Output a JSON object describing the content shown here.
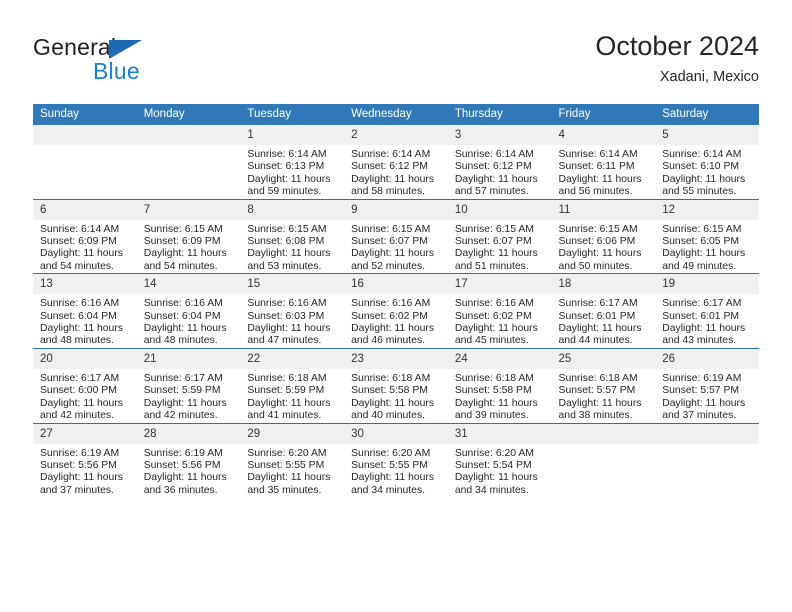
{
  "brand": {
    "name_line1": "General",
    "name_line2": "Blue",
    "accent_color": "#1b7fd4",
    "triangle_color": "#1b6ab3"
  },
  "header": {
    "title": "October 2024",
    "subtitle": "Xadani, Mexico",
    "header_bg": "#3178b9",
    "row_divider_color": "#2f6fa8",
    "daynum_bg": "#f0f0f0"
  },
  "weekdays": [
    "Sunday",
    "Monday",
    "Tuesday",
    "Wednesday",
    "Thursday",
    "Friday",
    "Saturday"
  ],
  "labels": {
    "sunrise_prefix": "Sunrise:",
    "sunset_prefix": "Sunset:",
    "daylight_prefix": "Daylight:"
  },
  "weeks": [
    [
      {
        "day": "",
        "sunrise": "",
        "sunset": "",
        "daylight": ""
      },
      {
        "day": "",
        "sunrise": "",
        "sunset": "",
        "daylight": ""
      },
      {
        "day": "1",
        "sunrise": "Sunrise: 6:14 AM",
        "sunset": "Sunset: 6:13 PM",
        "daylight": "Daylight: 11 hours and 59 minutes."
      },
      {
        "day": "2",
        "sunrise": "Sunrise: 6:14 AM",
        "sunset": "Sunset: 6:12 PM",
        "daylight": "Daylight: 11 hours and 58 minutes."
      },
      {
        "day": "3",
        "sunrise": "Sunrise: 6:14 AM",
        "sunset": "Sunset: 6:12 PM",
        "daylight": "Daylight: 11 hours and 57 minutes."
      },
      {
        "day": "4",
        "sunrise": "Sunrise: 6:14 AM",
        "sunset": "Sunset: 6:11 PM",
        "daylight": "Daylight: 11 hours and 56 minutes."
      },
      {
        "day": "5",
        "sunrise": "Sunrise: 6:14 AM",
        "sunset": "Sunset: 6:10 PM",
        "daylight": "Daylight: 11 hours and 55 minutes."
      }
    ],
    [
      {
        "day": "6",
        "sunrise": "Sunrise: 6:14 AM",
        "sunset": "Sunset: 6:09 PM",
        "daylight": "Daylight: 11 hours and 54 minutes."
      },
      {
        "day": "7",
        "sunrise": "Sunrise: 6:15 AM",
        "sunset": "Sunset: 6:09 PM",
        "daylight": "Daylight: 11 hours and 54 minutes."
      },
      {
        "day": "8",
        "sunrise": "Sunrise: 6:15 AM",
        "sunset": "Sunset: 6:08 PM",
        "daylight": "Daylight: 11 hours and 53 minutes."
      },
      {
        "day": "9",
        "sunrise": "Sunrise: 6:15 AM",
        "sunset": "Sunset: 6:07 PM",
        "daylight": "Daylight: 11 hours and 52 minutes."
      },
      {
        "day": "10",
        "sunrise": "Sunrise: 6:15 AM",
        "sunset": "Sunset: 6:07 PM",
        "daylight": "Daylight: 11 hours and 51 minutes."
      },
      {
        "day": "11",
        "sunrise": "Sunrise: 6:15 AM",
        "sunset": "Sunset: 6:06 PM",
        "daylight": "Daylight: 11 hours and 50 minutes."
      },
      {
        "day": "12",
        "sunrise": "Sunrise: 6:15 AM",
        "sunset": "Sunset: 6:05 PM",
        "daylight": "Daylight: 11 hours and 49 minutes."
      }
    ],
    [
      {
        "day": "13",
        "sunrise": "Sunrise: 6:16 AM",
        "sunset": "Sunset: 6:04 PM",
        "daylight": "Daylight: 11 hours and 48 minutes."
      },
      {
        "day": "14",
        "sunrise": "Sunrise: 6:16 AM",
        "sunset": "Sunset: 6:04 PM",
        "daylight": "Daylight: 11 hours and 48 minutes."
      },
      {
        "day": "15",
        "sunrise": "Sunrise: 6:16 AM",
        "sunset": "Sunset: 6:03 PM",
        "daylight": "Daylight: 11 hours and 47 minutes."
      },
      {
        "day": "16",
        "sunrise": "Sunrise: 6:16 AM",
        "sunset": "Sunset: 6:02 PM",
        "daylight": "Daylight: 11 hours and 46 minutes."
      },
      {
        "day": "17",
        "sunrise": "Sunrise: 6:16 AM",
        "sunset": "Sunset: 6:02 PM",
        "daylight": "Daylight: 11 hours and 45 minutes."
      },
      {
        "day": "18",
        "sunrise": "Sunrise: 6:17 AM",
        "sunset": "Sunset: 6:01 PM",
        "daylight": "Daylight: 11 hours and 44 minutes."
      },
      {
        "day": "19",
        "sunrise": "Sunrise: 6:17 AM",
        "sunset": "Sunset: 6:01 PM",
        "daylight": "Daylight: 11 hours and 43 minutes."
      }
    ],
    [
      {
        "day": "20",
        "sunrise": "Sunrise: 6:17 AM",
        "sunset": "Sunset: 6:00 PM",
        "daylight": "Daylight: 11 hours and 42 minutes."
      },
      {
        "day": "21",
        "sunrise": "Sunrise: 6:17 AM",
        "sunset": "Sunset: 5:59 PM",
        "daylight": "Daylight: 11 hours and 42 minutes."
      },
      {
        "day": "22",
        "sunrise": "Sunrise: 6:18 AM",
        "sunset": "Sunset: 5:59 PM",
        "daylight": "Daylight: 11 hours and 41 minutes."
      },
      {
        "day": "23",
        "sunrise": "Sunrise: 6:18 AM",
        "sunset": "Sunset: 5:58 PM",
        "daylight": "Daylight: 11 hours and 40 minutes."
      },
      {
        "day": "24",
        "sunrise": "Sunrise: 6:18 AM",
        "sunset": "Sunset: 5:58 PM",
        "daylight": "Daylight: 11 hours and 39 minutes."
      },
      {
        "day": "25",
        "sunrise": "Sunrise: 6:18 AM",
        "sunset": "Sunset: 5:57 PM",
        "daylight": "Daylight: 11 hours and 38 minutes."
      },
      {
        "day": "26",
        "sunrise": "Sunrise: 6:19 AM",
        "sunset": "Sunset: 5:57 PM",
        "daylight": "Daylight: 11 hours and 37 minutes."
      }
    ],
    [
      {
        "day": "27",
        "sunrise": "Sunrise: 6:19 AM",
        "sunset": "Sunset: 5:56 PM",
        "daylight": "Daylight: 11 hours and 37 minutes."
      },
      {
        "day": "28",
        "sunrise": "Sunrise: 6:19 AM",
        "sunset": "Sunset: 5:56 PM",
        "daylight": "Daylight: 11 hours and 36 minutes."
      },
      {
        "day": "29",
        "sunrise": "Sunrise: 6:20 AM",
        "sunset": "Sunset: 5:55 PM",
        "daylight": "Daylight: 11 hours and 35 minutes."
      },
      {
        "day": "30",
        "sunrise": "Sunrise: 6:20 AM",
        "sunset": "Sunset: 5:55 PM",
        "daylight": "Daylight: 11 hours and 34 minutes."
      },
      {
        "day": "31",
        "sunrise": "Sunrise: 6:20 AM",
        "sunset": "Sunset: 5:54 PM",
        "daylight": "Daylight: 11 hours and 34 minutes."
      },
      {
        "day": "",
        "sunrise": "",
        "sunset": "",
        "daylight": ""
      },
      {
        "day": "",
        "sunrise": "",
        "sunset": "",
        "daylight": ""
      }
    ]
  ]
}
